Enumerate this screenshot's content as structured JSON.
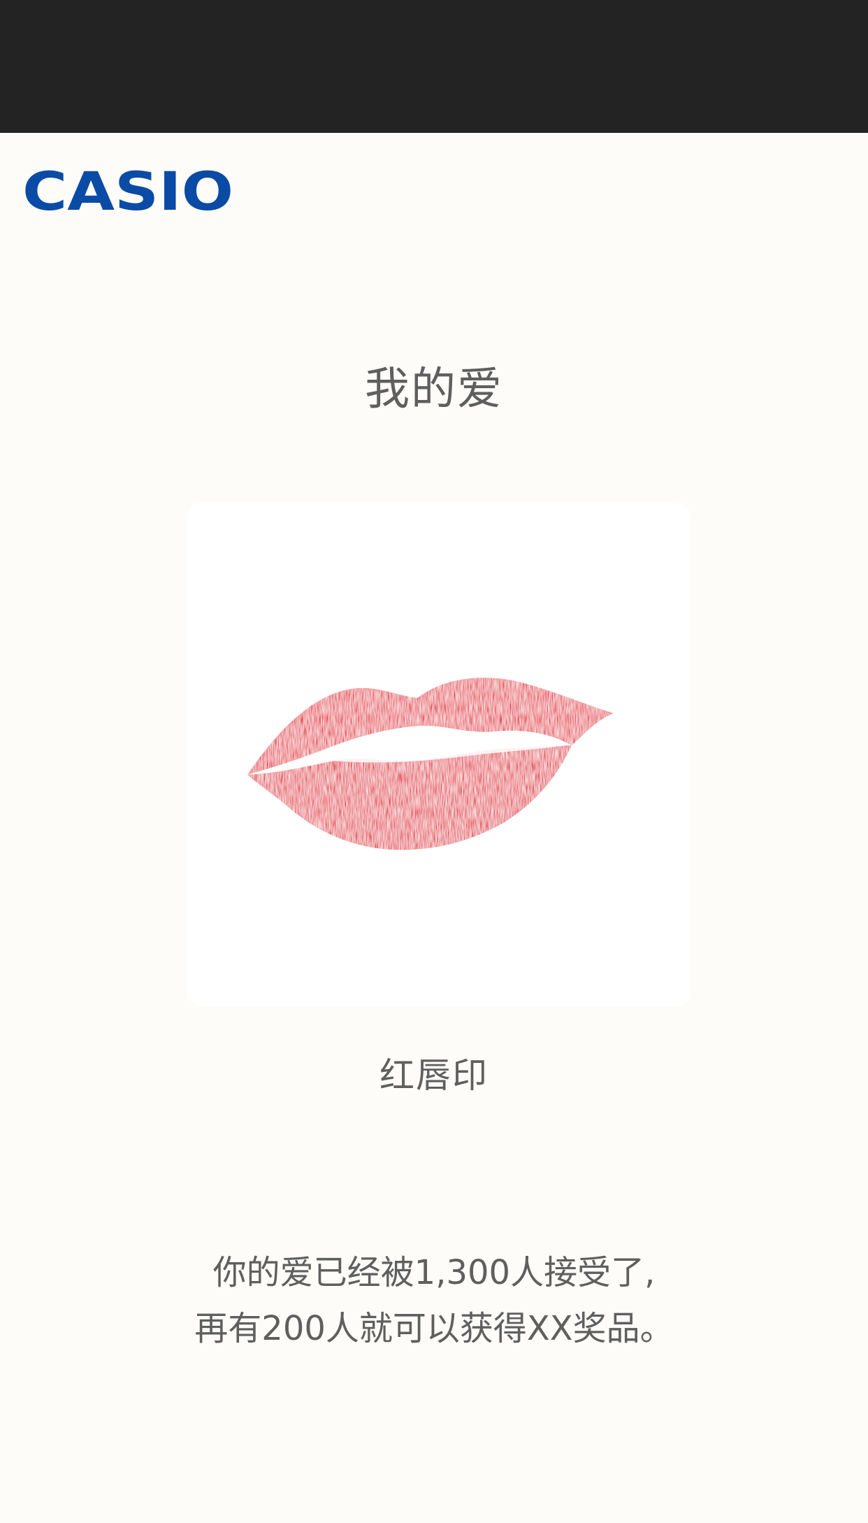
{
  "brand": {
    "logo_text": "CASIO",
    "logo_color": "#0a4ba5"
  },
  "page": {
    "title": "我的爱"
  },
  "card": {
    "image_icon": "red-lips-print",
    "lip_color": "#e8283e",
    "caption": "红唇印"
  },
  "message": {
    "line1": "你的爱已经被1,300人接受了,",
    "line2": "再有200人就可以获得XX奖品。"
  }
}
